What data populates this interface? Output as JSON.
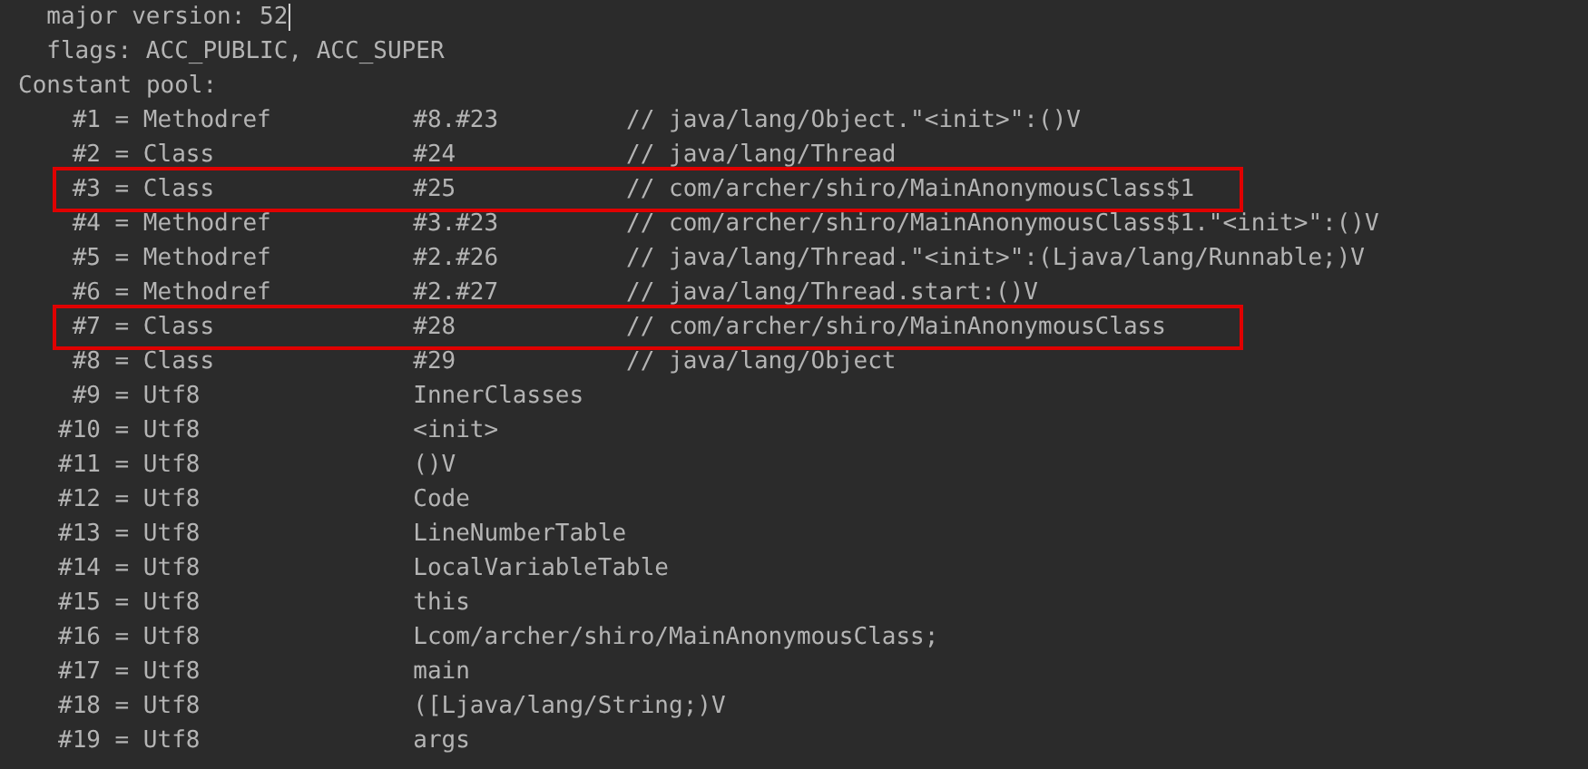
{
  "header_lines": [
    {
      "text": "major version: 52",
      "cursor": true
    },
    {
      "text": "flags: ACC_PUBLIC, ACC_SUPER",
      "cursor": false
    }
  ],
  "section_title": "Constant pool:",
  "constant_pool": [
    {
      "sep": "=",
      "index": "#1",
      "type": "Methodref",
      "ref": "#8.#23",
      "comment": "// java/lang/Object.\"<init>\":()V",
      "highlighted": false
    },
    {
      "sep": "=",
      "index": "#2",
      "type": "Class",
      "ref": "#24",
      "comment": "// java/lang/Thread",
      "highlighted": false
    },
    {
      "sep": "=",
      "index": "#3",
      "type": "Class",
      "ref": "#25",
      "comment": "// com/archer/shiro/MainAnonymousClass$1",
      "highlighted": true
    },
    {
      "sep": "=",
      "index": "#4",
      "type": "Methodref",
      "ref": "#3.#23",
      "comment": "// com/archer/shiro/MainAnonymousClass$1.\"<init>\":()V",
      "highlighted": false
    },
    {
      "sep": "=",
      "index": "#5",
      "type": "Methodref",
      "ref": "#2.#26",
      "comment": "// java/lang/Thread.\"<init>\":(Ljava/lang/Runnable;)V",
      "highlighted": false
    },
    {
      "sep": "=",
      "index": "#6",
      "type": "Methodref",
      "ref": "#2.#27",
      "comment": "// java/lang/Thread.start:()V",
      "highlighted": false
    },
    {
      "sep": "=",
      "index": "#7",
      "type": "Class",
      "ref": "#28",
      "comment": "// com/archer/shiro/MainAnonymousClass",
      "highlighted": true
    },
    {
      "sep": "=",
      "index": "#8",
      "type": "Class",
      "ref": "#29",
      "comment": "// java/lang/Object",
      "highlighted": false
    },
    {
      "sep": "=",
      "index": "#9",
      "type": "Utf8",
      "ref": "InnerClasses",
      "highlighted": false
    },
    {
      "sep": "=",
      "index": "#10",
      "type": "Utf8",
      "ref": "<init>",
      "highlighted": false
    },
    {
      "sep": "=",
      "index": "#11",
      "type": "Utf8",
      "ref": "()V",
      "highlighted": false
    },
    {
      "sep": "=",
      "index": "#12",
      "type": "Utf8",
      "ref": "Code",
      "highlighted": false
    },
    {
      "sep": "=",
      "index": "#13",
      "type": "Utf8",
      "ref": "LineNumberTable",
      "highlighted": false
    },
    {
      "sep": "=",
      "index": "#14",
      "type": "Utf8",
      "ref": "LocalVariableTable",
      "highlighted": false
    },
    {
      "sep": "=",
      "index": "#15",
      "type": "Utf8",
      "ref": "this",
      "highlighted": false
    },
    {
      "sep": "=",
      "index": "#16",
      "type": "Utf8",
      "ref": "Lcom/archer/shiro/MainAnonymousClass;",
      "highlighted": false
    },
    {
      "sep": "=",
      "index": "#17",
      "type": "Utf8",
      "ref": "main",
      "highlighted": false
    },
    {
      "sep": "=",
      "index": "#18",
      "type": "Utf8",
      "ref": "([Ljava/lang/String;)V",
      "highlighted": false
    },
    {
      "sep": "=",
      "index": "#19",
      "type": "Utf8",
      "ref": "args",
      "highlighted": false
    }
  ]
}
